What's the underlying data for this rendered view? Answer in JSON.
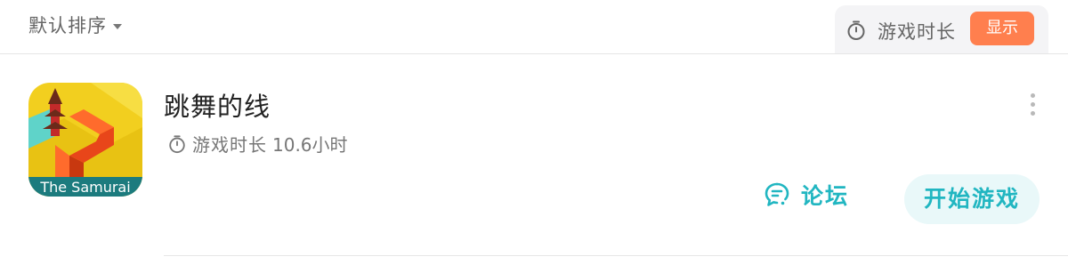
{
  "sort": {
    "label": "默认排序",
    "icon": "caret-down-icon"
  },
  "playtime_toggle": {
    "label": "游戏时长",
    "button_label": "显示",
    "icon": "stopwatch-icon"
  },
  "game": {
    "title": "跳舞的线",
    "playtime_label": "游戏时长",
    "playtime_value": "10.6小时",
    "icon_banner": "The Samurai",
    "forum_label": "论坛",
    "start_label": "开始游戏"
  },
  "colors": {
    "accent_teal": "#21b6c1",
    "toggle_orange": "#ff7f4e",
    "start_bg": "#e9f8f9"
  }
}
